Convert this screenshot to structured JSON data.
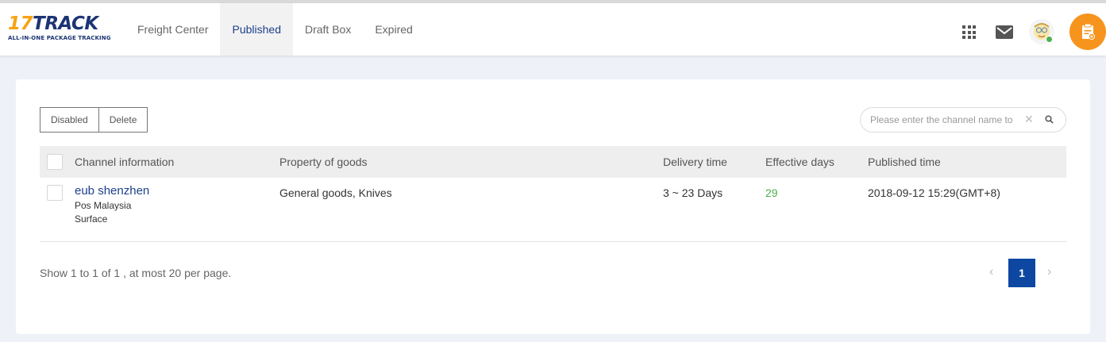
{
  "header": {
    "logo": {
      "main": "17TRACK",
      "num": "17",
      "brand": "TRACK",
      "tagline": "ALL-IN-ONE PACKAGE TRACKING"
    },
    "nav": [
      {
        "label": "Freight Center",
        "active": false
      },
      {
        "label": "Published",
        "active": true
      },
      {
        "label": "Draft Box",
        "active": false
      },
      {
        "label": "Expired",
        "active": false
      }
    ],
    "icons": [
      "apps-grid-icon",
      "mail-icon",
      "avatar",
      "add-channel-icon"
    ],
    "colors": {
      "accent": "#1d3f8a",
      "orange": "#f7941d",
      "page_active": "#0d47a1",
      "effective_days": "#4caf50"
    }
  },
  "toolbar": {
    "disabled_label": "Disabled",
    "delete_label": "Delete",
    "search_placeholder": "Please enter the channel name to",
    "search_value": ""
  },
  "table": {
    "columns": [
      "Channel information",
      "Property of goods",
      "Delivery time",
      "Effective days",
      "Published time"
    ],
    "rows": [
      {
        "channel_name": "eub shenzhen",
        "carrier": "Pos Malaysia",
        "service": "Surface",
        "property": "General goods, Knives",
        "delivery_time": "3 ~ 23 Days",
        "effective_days": "29",
        "published_time": "2018-09-12 15:29(GMT+8)"
      }
    ]
  },
  "pagination": {
    "summary": "Show 1 to 1 of 1 , at most 20 per page.",
    "current_page": "1",
    "prev": "‹",
    "next": "›"
  }
}
